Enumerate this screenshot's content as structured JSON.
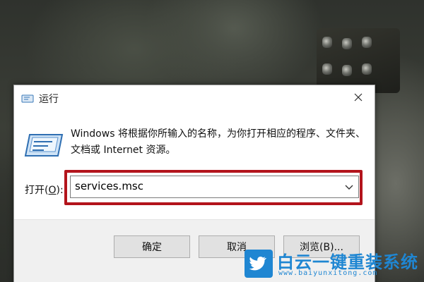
{
  "dialog": {
    "title": "运行",
    "description": "Windows 将根据你所输入的名称，为你打开相应的程序、文件夹、文档或 Internet 资源。",
    "open_label_prefix": "打开(",
    "open_label_accel": "O",
    "open_label_suffix": "):",
    "input_value": "services.msc",
    "ok_label": "确定",
    "cancel_label": "取消",
    "browse_label": "浏览(B)...",
    "highlight_color": "#b3141c"
  },
  "icons": {
    "title": "run-icon",
    "big": "run-icon",
    "close": "close-icon",
    "dropdown": "chevron-down-icon"
  },
  "watermark": {
    "title": "白云一键重装系统",
    "url": "www.baiyunxitong.com",
    "color": "#1f86d2"
  }
}
